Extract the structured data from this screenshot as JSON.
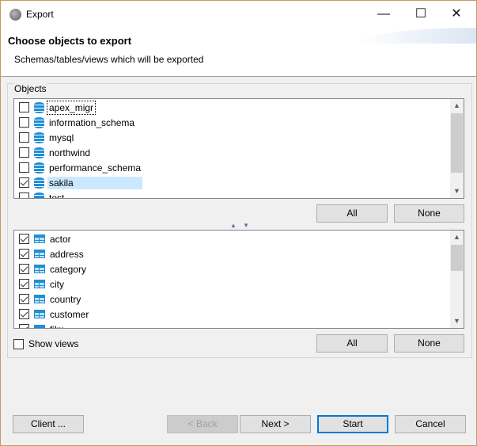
{
  "window": {
    "title": "Export",
    "minimize": "—",
    "maximize": "☐",
    "close": "✕"
  },
  "header": {
    "title": "Choose objects to export",
    "subtitle": "Schemas/tables/views which will be exported"
  },
  "group": {
    "label": "Objects"
  },
  "schemas": [
    {
      "name": "apex_migr",
      "checked": false
    },
    {
      "name": "information_schema",
      "checked": false
    },
    {
      "name": "mysql",
      "checked": false
    },
    {
      "name": "northwind",
      "checked": false
    },
    {
      "name": "performance_schema",
      "checked": false
    },
    {
      "name": "sakila",
      "checked": true,
      "selected": true
    },
    {
      "name": "test",
      "checked": false
    }
  ],
  "tables": [
    {
      "name": "actor",
      "checked": true
    },
    {
      "name": "address",
      "checked": true
    },
    {
      "name": "category",
      "checked": true
    },
    {
      "name": "city",
      "checked": true
    },
    {
      "name": "country",
      "checked": true
    },
    {
      "name": "customer",
      "checked": true
    },
    {
      "name": "film",
      "checked": true
    }
  ],
  "schema_buttons": {
    "all": "All",
    "none": "None"
  },
  "table_buttons": {
    "all": "All",
    "none": "None"
  },
  "show_views": {
    "label": "Show views",
    "checked": false
  },
  "footer": {
    "client": "Client ...",
    "back": "< Back",
    "next": "Next >",
    "start": "Start",
    "cancel": "Cancel"
  },
  "splitter": "▲ ▼"
}
